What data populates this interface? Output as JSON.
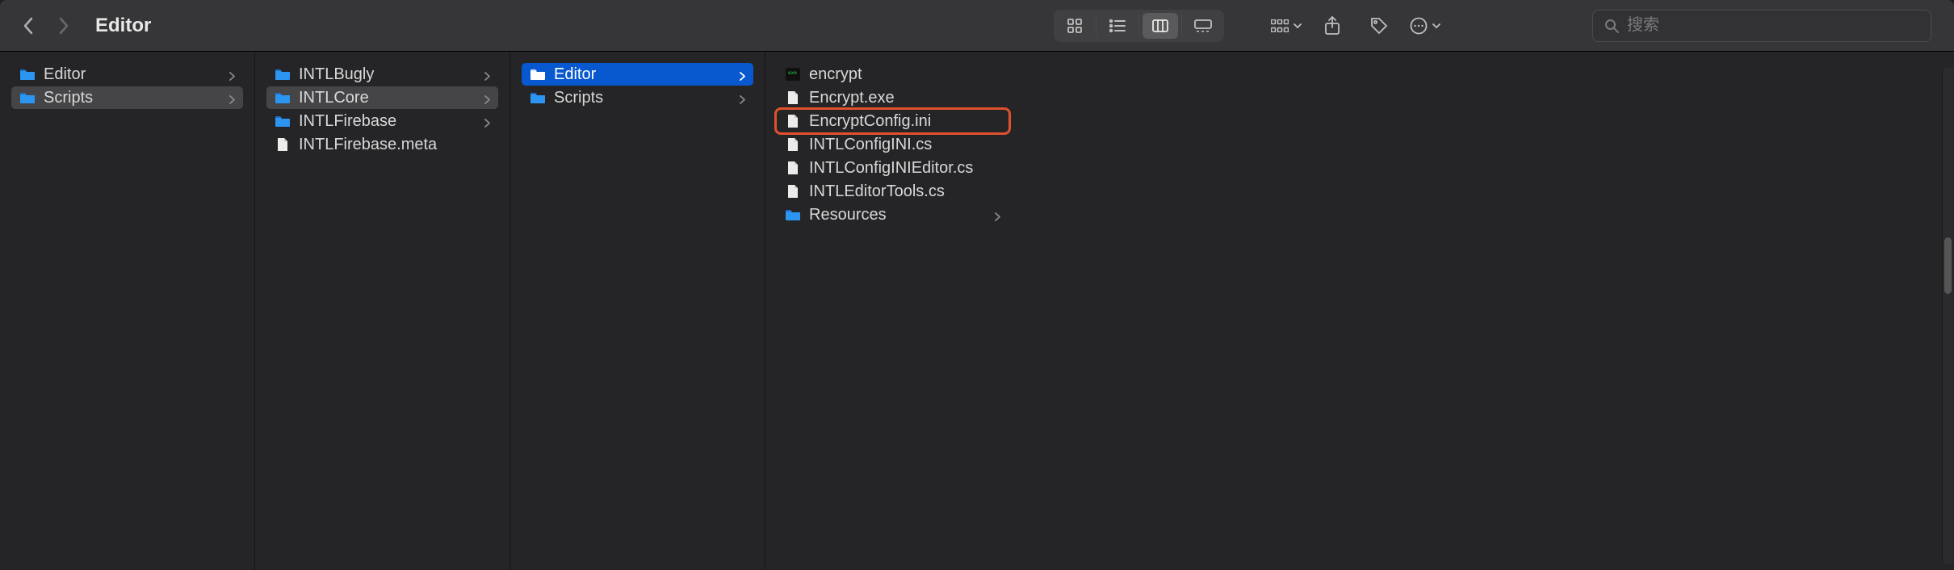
{
  "toolbar": {
    "title": "Editor",
    "search_placeholder": "搜索"
  },
  "columns": [
    {
      "items": [
        {
          "type": "folder",
          "label": "Editor",
          "selected": false,
          "has_chevron": true
        },
        {
          "type": "folder",
          "label": "Scripts",
          "selected": "gray",
          "has_chevron": true
        }
      ]
    },
    {
      "items": [
        {
          "type": "folder",
          "label": "INTLBugly",
          "selected": false,
          "has_chevron": true
        },
        {
          "type": "folder",
          "label": "INTLCore",
          "selected": "gray",
          "has_chevron": true
        },
        {
          "type": "folder",
          "label": "INTLFirebase",
          "selected": false,
          "has_chevron": true
        },
        {
          "type": "file",
          "label": "INTLFirebase.meta",
          "selected": false,
          "has_chevron": false
        }
      ]
    },
    {
      "items": [
        {
          "type": "folder",
          "label": "Editor",
          "selected": "blue",
          "has_chevron": true
        },
        {
          "type": "folder",
          "label": "Scripts",
          "selected": false,
          "has_chevron": true
        }
      ]
    },
    {
      "items": [
        {
          "type": "exec",
          "label": "encrypt",
          "selected": false,
          "has_chevron": false
        },
        {
          "type": "file",
          "label": "Encrypt.exe",
          "selected": false,
          "has_chevron": false
        },
        {
          "type": "file",
          "label": "EncryptConfig.ini",
          "selected": false,
          "has_chevron": false,
          "highlight": true
        },
        {
          "type": "file",
          "label": "INTLConfigINI.cs",
          "selected": false,
          "has_chevron": false
        },
        {
          "type": "file",
          "label": "INTLConfigINIEditor.cs",
          "selected": false,
          "has_chevron": false
        },
        {
          "type": "file",
          "label": "INTLEditorTools.cs",
          "selected": false,
          "has_chevron": false
        },
        {
          "type": "folder",
          "label": "Resources",
          "selected": false,
          "has_chevron": true
        }
      ]
    }
  ]
}
